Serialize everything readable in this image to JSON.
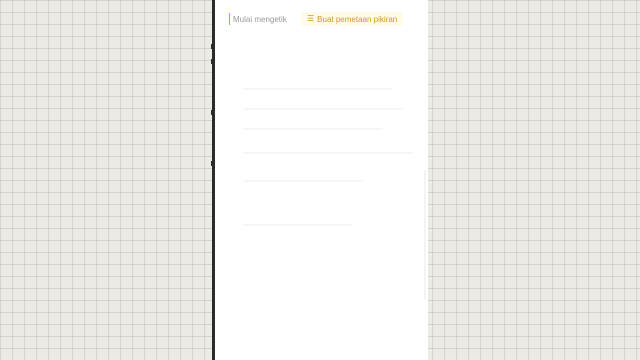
{
  "editor": {
    "input_placeholder": "Mulai mengetik",
    "mindmap_button_label": "Buat pemetaan pikiran",
    "mindmap_icon": "list-icon"
  },
  "colors": {
    "accent": "#d49a1a",
    "accent_bg": "#fffbe9",
    "grid_bg": "#eceae4",
    "frame": "#2b2b2b"
  }
}
